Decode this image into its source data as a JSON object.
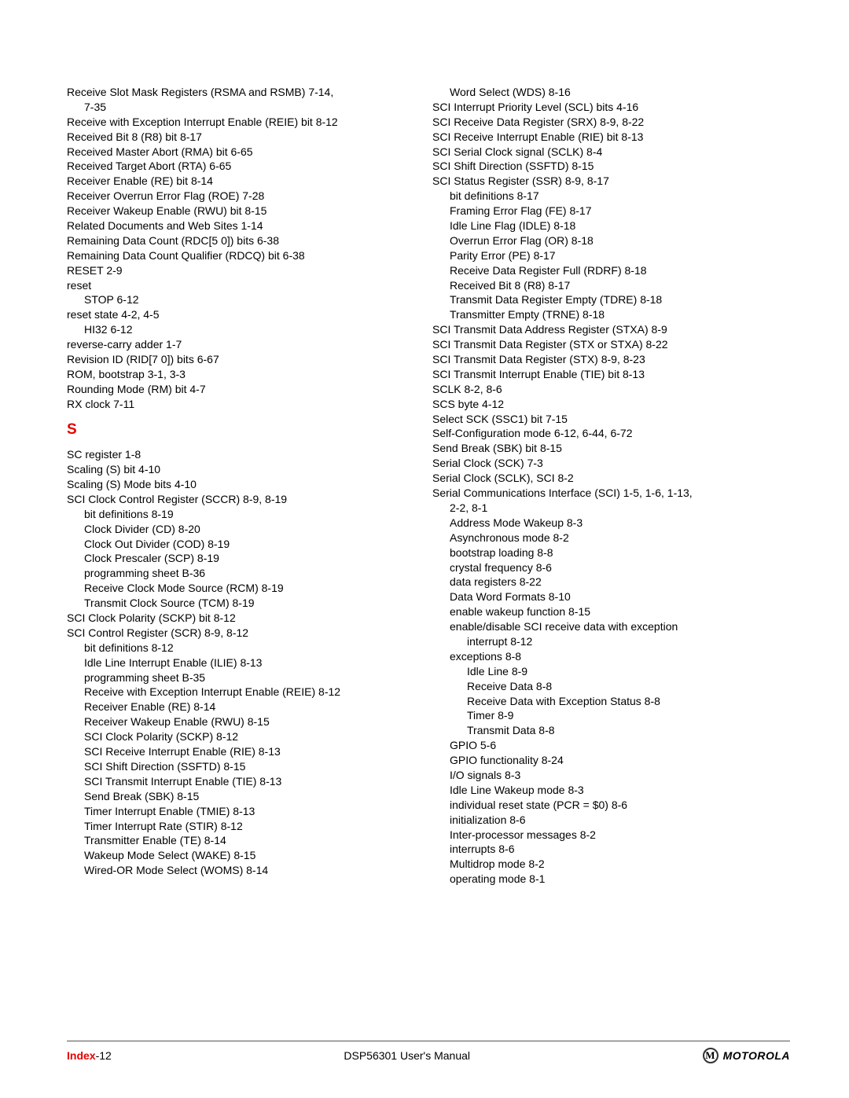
{
  "footer": {
    "page_label_prefix": "Index",
    "page_label_suffix": "-12",
    "doc_title": "DSP56301 User's Manual",
    "brand": "MOTOROLA",
    "brand_glyph": "M"
  },
  "section_letter": "S",
  "left_col": [
    {
      "t": "Receive Slot Mask Registers (RSMA and RSMB) 7-14,",
      "i": 0
    },
    {
      "t": "7-35",
      "i": 1
    },
    {
      "t": "Receive with Exception Interrupt Enable (REIE) bit 8-12",
      "i": 0
    },
    {
      "t": "Received Bit 8 (R8) bit 8-17",
      "i": 0
    },
    {
      "t": "Received Master Abort (RMA) bit 6-65",
      "i": 0
    },
    {
      "t": "Received Target Abort (RTA) 6-65",
      "i": 0
    },
    {
      "t": "Receiver Enable (RE) bit 8-14",
      "i": 0
    },
    {
      "t": "Receiver Overrun Error Flag (ROE) 7-28",
      "i": 0
    },
    {
      "t": "Receiver Wakeup Enable (RWU) bit 8-15",
      "i": 0
    },
    {
      "t": "Related Documents and Web Sites 1-14",
      "i": 0
    },
    {
      "t": "Remaining Data Count (RDC[5 0]) bits 6-38",
      "i": 0
    },
    {
      "t": "Remaining Data Count Qualifier (RDCQ) bit 6-38",
      "i": 0
    },
    {
      "t": "RESET 2-9",
      "i": 0
    },
    {
      "t": "reset",
      "i": 0
    },
    {
      "t": "STOP 6-12",
      "i": 1
    },
    {
      "t": "reset state 4-2, 4-5",
      "i": 0
    },
    {
      "t": "HI32 6-12",
      "i": 1
    },
    {
      "t": "reverse-carry adder 1-7",
      "i": 0
    },
    {
      "t": "Revision ID (RID[7 0]) bits 6-67",
      "i": 0
    },
    {
      "t": "ROM, bootstrap 3-1, 3-3",
      "i": 0
    },
    {
      "t": "Rounding Mode (RM) bit 4-7",
      "i": 0
    },
    {
      "t": "RX clock 7-11",
      "i": 0
    },
    {
      "t": "__SECTION__",
      "i": 0
    },
    {
      "t": "SC register 1-8",
      "i": 0
    },
    {
      "t": "Scaling (S) bit 4-10",
      "i": 0
    },
    {
      "t": "Scaling (S) Mode bits 4-10",
      "i": 0
    },
    {
      "t": "SCI Clock Control Register (SCCR) 8-9, 8-19",
      "i": 0
    },
    {
      "t": "bit definitions 8-19",
      "i": 1
    },
    {
      "t": "Clock Divider (CD) 8-20",
      "i": 1
    },
    {
      "t": "Clock Out Divider (COD) 8-19",
      "i": 1
    },
    {
      "t": "Clock Prescaler (SCP) 8-19",
      "i": 1
    },
    {
      "t": "programming sheet B-36",
      "i": 1
    },
    {
      "t": "Receive Clock Mode Source (RCM) 8-19",
      "i": 1
    },
    {
      "t": "Transmit Clock Source (TCM) 8-19",
      "i": 1
    },
    {
      "t": "SCI Clock Polarity (SCKP) bit 8-12",
      "i": 0
    },
    {
      "t": "SCI Control Register (SCR) 8-9, 8-12",
      "i": 0
    },
    {
      "t": "bit definitions 8-12",
      "i": 1
    },
    {
      "t": "Idle Line Interrupt Enable (ILIE) 8-13",
      "i": 1
    },
    {
      "t": "programming sheet B-35",
      "i": 1
    },
    {
      "t": "Receive with Exception Interrupt Enable (REIE) 8-12",
      "i": 1
    },
    {
      "t": "Receiver Enable (RE) 8-14",
      "i": 1
    },
    {
      "t": "Receiver Wakeup Enable (RWU) 8-15",
      "i": 1
    },
    {
      "t": "SCI Clock Polarity (SCKP) 8-12",
      "i": 1
    },
    {
      "t": "SCI Receive Interrupt Enable (RIE) 8-13",
      "i": 1
    },
    {
      "t": "SCI Shift Direction (SSFTD) 8-15",
      "i": 1
    },
    {
      "t": "SCI Transmit Interrupt Enable (TIE) 8-13",
      "i": 1
    },
    {
      "t": "Send Break (SBK) 8-15",
      "i": 1
    },
    {
      "t": "Timer Interrupt Enable (TMIE) 8-13",
      "i": 1
    },
    {
      "t": "Timer Interrupt Rate (STIR) 8-12",
      "i": 1
    },
    {
      "t": "Transmitter Enable (TE) 8-14",
      "i": 1
    },
    {
      "t": "Wakeup Mode Select (WAKE) 8-15",
      "i": 1
    },
    {
      "t": "Wired-OR Mode Select (WOMS) 8-14",
      "i": 1
    }
  ],
  "right_col": [
    {
      "t": "Word Select (WDS) 8-16",
      "i": 1
    },
    {
      "t": "SCI Interrupt Priority Level (SCL) bits 4-16",
      "i": 0
    },
    {
      "t": "SCI Receive Data Register (SRX) 8-9, 8-22",
      "i": 0
    },
    {
      "t": "SCI Receive Interrupt Enable (RIE) bit 8-13",
      "i": 0
    },
    {
      "t": "SCI Serial Clock signal (SCLK) 8-4",
      "i": 0
    },
    {
      "t": "SCI Shift Direction (SSFTD) 8-15",
      "i": 0
    },
    {
      "t": "SCI Status Register (SSR) 8-9, 8-17",
      "i": 0
    },
    {
      "t": "bit definitions 8-17",
      "i": 1
    },
    {
      "t": "Framing Error Flag (FE) 8-17",
      "i": 1
    },
    {
      "t": "Idle Line Flag (IDLE) 8-18",
      "i": 1
    },
    {
      "t": "Overrun Error Flag (OR) 8-18",
      "i": 1
    },
    {
      "t": "Parity Error (PE) 8-17",
      "i": 1
    },
    {
      "t": "Receive Data Register Full (RDRF) 8-18",
      "i": 1
    },
    {
      "t": "Received Bit 8 (R8) 8-17",
      "i": 1
    },
    {
      "t": "Transmit Data Register Empty (TDRE) 8-18",
      "i": 1
    },
    {
      "t": "Transmitter Empty (TRNE) 8-18",
      "i": 1
    },
    {
      "t": "SCI Transmit Data Address Register (STXA) 8-9",
      "i": 0
    },
    {
      "t": "SCI Transmit Data Register (STX or STXA) 8-22",
      "i": 0
    },
    {
      "t": "SCI Transmit Data Register (STX) 8-9, 8-23",
      "i": 0
    },
    {
      "t": "SCI Transmit Interrupt Enable (TIE) bit 8-13",
      "i": 0
    },
    {
      "t": "SCLK 8-2, 8-6",
      "i": 0
    },
    {
      "t": "SCS byte 4-12",
      "i": 0
    },
    {
      "t": "Select SCK (SSC1) bit 7-15",
      "i": 0
    },
    {
      "t": "Self-Configuration mode 6-12, 6-44, 6-72",
      "i": 0
    },
    {
      "t": "Send Break (SBK) bit 8-15",
      "i": 0
    },
    {
      "t": "Serial Clock (SCK) 7-3",
      "i": 0
    },
    {
      "t": "Serial Clock (SCLK), SCI 8-2",
      "i": 0
    },
    {
      "t": "Serial Communications Interface (SCI) 1-5, 1-6, 1-13,",
      "i": 0
    },
    {
      "t": "2-2, 8-1",
      "i": 1
    },
    {
      "t": "Address Mode Wakeup 8-3",
      "i": 1
    },
    {
      "t": "Asynchronous mode 8-2",
      "i": 1
    },
    {
      "t": "bootstrap loading 8-8",
      "i": 1
    },
    {
      "t": "crystal frequency 8-6",
      "i": 1
    },
    {
      "t": "data registers 8-22",
      "i": 1
    },
    {
      "t": "Data Word Formats 8-10",
      "i": 1
    },
    {
      "t": "enable wakeup function 8-15",
      "i": 1
    },
    {
      "t": "enable/disable SCI receive data with exception",
      "i": 1
    },
    {
      "t": "interrupt 8-12",
      "i": 2
    },
    {
      "t": "exceptions 8-8",
      "i": 1
    },
    {
      "t": "Idle Line 8-9",
      "i": 2
    },
    {
      "t": "Receive Data 8-8",
      "i": 2
    },
    {
      "t": "Receive Data with Exception Status 8-8",
      "i": 2
    },
    {
      "t": "Timer 8-9",
      "i": 2
    },
    {
      "t": "Transmit Data 8-8",
      "i": 2
    },
    {
      "t": "GPIO 5-6",
      "i": 1
    },
    {
      "t": "GPIO functionality 8-24",
      "i": 1
    },
    {
      "t": "I/O signals 8-3",
      "i": 1
    },
    {
      "t": "Idle Line Wakeup mode 8-3",
      "i": 1
    },
    {
      "t": "individual reset state (PCR = $0) 8-6",
      "i": 1
    },
    {
      "t": "initialization 8-6",
      "i": 1
    },
    {
      "t": "Inter-processor messages 8-2",
      "i": 1
    },
    {
      "t": "interrupts 8-6",
      "i": 1
    },
    {
      "t": "Multidrop mode 8-2",
      "i": 1
    },
    {
      "t": "operating mode 8-1",
      "i": 1
    }
  ]
}
